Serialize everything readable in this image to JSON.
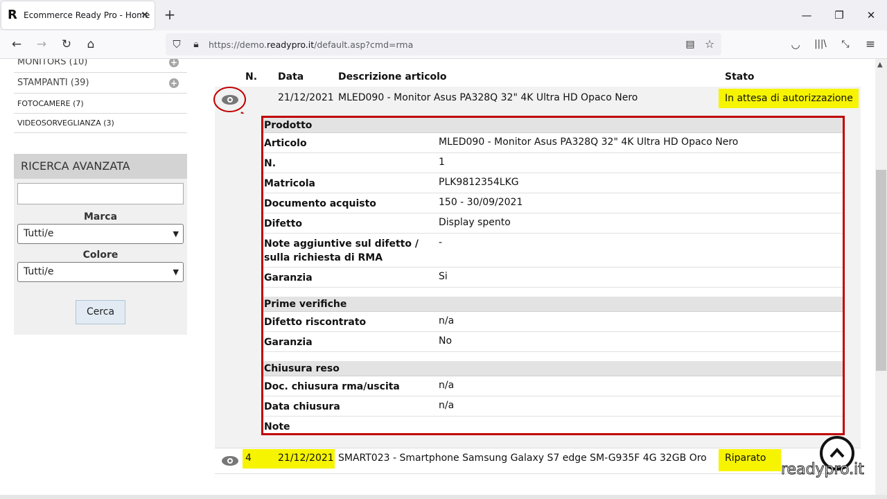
{
  "browser": {
    "tab_title": "Ecommerce Ready Pro - Home",
    "favicon_letter": "R",
    "url_prefix": "https://demo.",
    "url_domain": "readypro.it",
    "url_path": "/default.asp?cmd=rma"
  },
  "sidebar": {
    "categories": [
      {
        "label": "MONITORS (10)"
      },
      {
        "label": "STAMPANTI (39)"
      },
      {
        "label": "FOTOCAMERE (7)"
      },
      {
        "label": "VIDEOSORVEGLIANZA (3)"
      }
    ],
    "advanced_search": {
      "title": "RICERCA AVANZATA",
      "brand_label": "Marca",
      "brand_value": "Tutti/e",
      "color_label": "Colore",
      "color_value": "Tutti/e",
      "search_button": "Cerca"
    }
  },
  "table": {
    "headers": {
      "number": "N.",
      "date": "Data",
      "description": "Descrizione articolo",
      "status": "Stato"
    },
    "row1": {
      "date": "21/12/2021",
      "description": "MLED090 - Monitor Asus PA328Q 32\" 4K Ultra HD Opaco Nero",
      "status": "In attesa di autorizzazione"
    },
    "row2": {
      "number": "4",
      "date": "21/12/2021",
      "description": "SMART023 - Smartphone Samsung Galaxy S7 edge SM-G935F 4G 32GB Oro",
      "status": "Riparato"
    }
  },
  "detail": {
    "product_section": "Prodotto",
    "product_rows": [
      {
        "label": "Articolo",
        "value": "MLED090 - Monitor Asus PA328Q 32\" 4K Ultra HD Opaco Nero"
      },
      {
        "label": "N.",
        "value": "1"
      },
      {
        "label": "Matricola",
        "value": "PLK9812354LKG"
      },
      {
        "label": "Documento acquisto",
        "value": "150 - 30/09/2021"
      },
      {
        "label": "Difetto",
        "value": "Display spento"
      },
      {
        "label": "Note aggiuntive sul difetto / sulla richiesta di RMA",
        "value": "-"
      },
      {
        "label": "Garanzia",
        "value": "Si"
      }
    ],
    "check_section": "Prime verifiche",
    "check_rows": [
      {
        "label": "Difetto riscontrato",
        "value": "n/a"
      },
      {
        "label": "Garanzia",
        "value": "No"
      }
    ],
    "close_section": "Chiusura reso",
    "close_rows": [
      {
        "label": "Doc. chiusura rma/uscita",
        "value": "n/a"
      },
      {
        "label": "Data chiusura",
        "value": "n/a"
      },
      {
        "label": "Note",
        "value": ""
      }
    ]
  },
  "watermark": "readypro.it",
  "colors": {
    "highlight": "#f6f400",
    "annotation": "#c00000"
  }
}
